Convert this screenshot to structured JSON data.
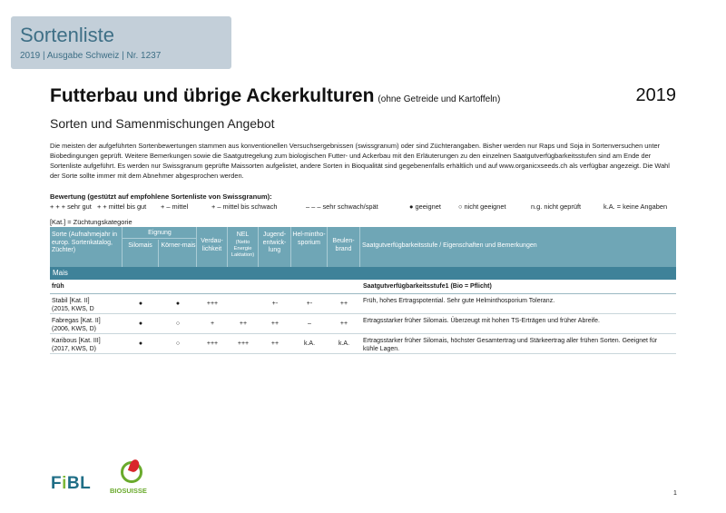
{
  "header": {
    "title": "Sortenliste",
    "subtitle": "2019 | Ausgabe Schweiz | Nr. 1237"
  },
  "main": {
    "title": "Futterbau und übrige Ackerkulturen",
    "title_suffix": "(ohne Getreide und Kartoffeln)",
    "year": "2019",
    "subtitle": "Sorten und Samenmischungen Angebot",
    "intro": "Die meisten der aufgeführten Sortenbewertungen stammen aus konventionellen Versuchsergebnissen (swissgranum) oder sind Züchterangaben. Bisher werden nur Raps und Soja in Sortenversuchen unter Biobedingungen geprüft. Weitere Bemerkungen sowie die Saatgutregelung zum biologischen Futter- und Ackerbau mit den Erläuterungen zu den einzelnen Saatgutverfügbarkeitsstufen sind am Ende der Sortenliste aufgeführt. Es werden nur Swissgranum geprüfte Maissorten aufgelistet, andere Sorten in Bioqualität sind gegebenenfalls erhältlich und auf www.organicxseeds.ch als verfügbar angezeigt. Die Wahl der Sorte sollte immer mit dem Abnehmer abgesprochen werden."
  },
  "legend": {
    "title": "Bewertung (gestützt auf empfohlene Sortenliste von Swissgranum):",
    "items": [
      "+ + +  sehr gut",
      "+ +  mittel bis gut",
      "+ –  mittel",
      "+ –  mittel bis schwach",
      "– – –  sehr schwach/spät",
      "●  geeignet",
      "○  nicht geeignet",
      "n.g. nicht geprüft",
      "k.A. = keine Angaben"
    ],
    "kat_note": "[Kat.] = Züchtungskategorie"
  },
  "table": {
    "headers": {
      "sorte": "Sorte (Aufnahmejahr in europ. Sortenkatalog, Züchter)",
      "eignung": "Eignung",
      "silomais": "Silomais",
      "koernermais": "Körner-mais",
      "verdaulichkeit": "Verdau-lichkeit",
      "nel": "NEL",
      "nel_sub": "(Netto Energie Laktation)",
      "jugend": "Jugend-entwick-lung",
      "helminthosporium": "Hel-mintho-sporium",
      "beulenbrand": "Beulen-brand",
      "stufe": "Saatgutverfügbarkeitsstufe / Eigenschaften und Bemerkungen"
    },
    "section": "Mais",
    "group": {
      "name": "früh",
      "stufe": "Saatgutverfügbarkeitsstufe1 (Bio = Pflicht)"
    },
    "rows": [
      {
        "name_line1": "Stabil  [Kat. II]",
        "name_line2": "(2015, KWS, D",
        "silomais": "●",
        "koernermais": "●",
        "verdaulichkeit": "+++",
        "nel": "",
        "jugend": "+-",
        "helminthosporium": "+-",
        "beulenbrand": "++",
        "note": "Früh, hohes Ertragspotential. Sehr gute Helminthosporium Toleranz."
      },
      {
        "name_line1": "Fabregas  [Kat. II]",
        "name_line2": "(2006, KWS, D)",
        "silomais": "●",
        "koernermais": "○",
        "verdaulichkeit": "+",
        "nel": "++",
        "jugend": "++",
        "helminthosporium": "–",
        "beulenbrand": "++",
        "note": "Ertragsstarker früher Silomais. Überzeugt mit hohen TS-Erträgen und früher Abreife."
      },
      {
        "name_line1": "Karibous  [Kat. III]",
        "name_line2": "(2017, KWS, D)",
        "silomais": "●",
        "koernermais": "○",
        "verdaulichkeit": "+++",
        "nel": "+++",
        "jugend": "++",
        "helminthosporium": "k.A.",
        "beulenbrand": "k.A.",
        "note": "Ertragsstarker früher Silomais, höchster Gesamtertrag und Stärkeertrag aller frühen Sorten. Geeignet für kühle Lagen."
      }
    ]
  },
  "footer": {
    "fibl_prefix": "F",
    "fibl_i": "i",
    "fibl_suffix": "BL",
    "biosuisse": "BIOSUISSE",
    "page": "1"
  },
  "colors": {
    "header_bg": "#c3cfd9",
    "header_text": "#3e6f86",
    "table_header": "#6fa6b6",
    "section_bar": "#3f8299",
    "fibl_blue": "#1f6e86",
    "bio_green": "#6aaa2c",
    "bio_red": "#d9262b"
  }
}
